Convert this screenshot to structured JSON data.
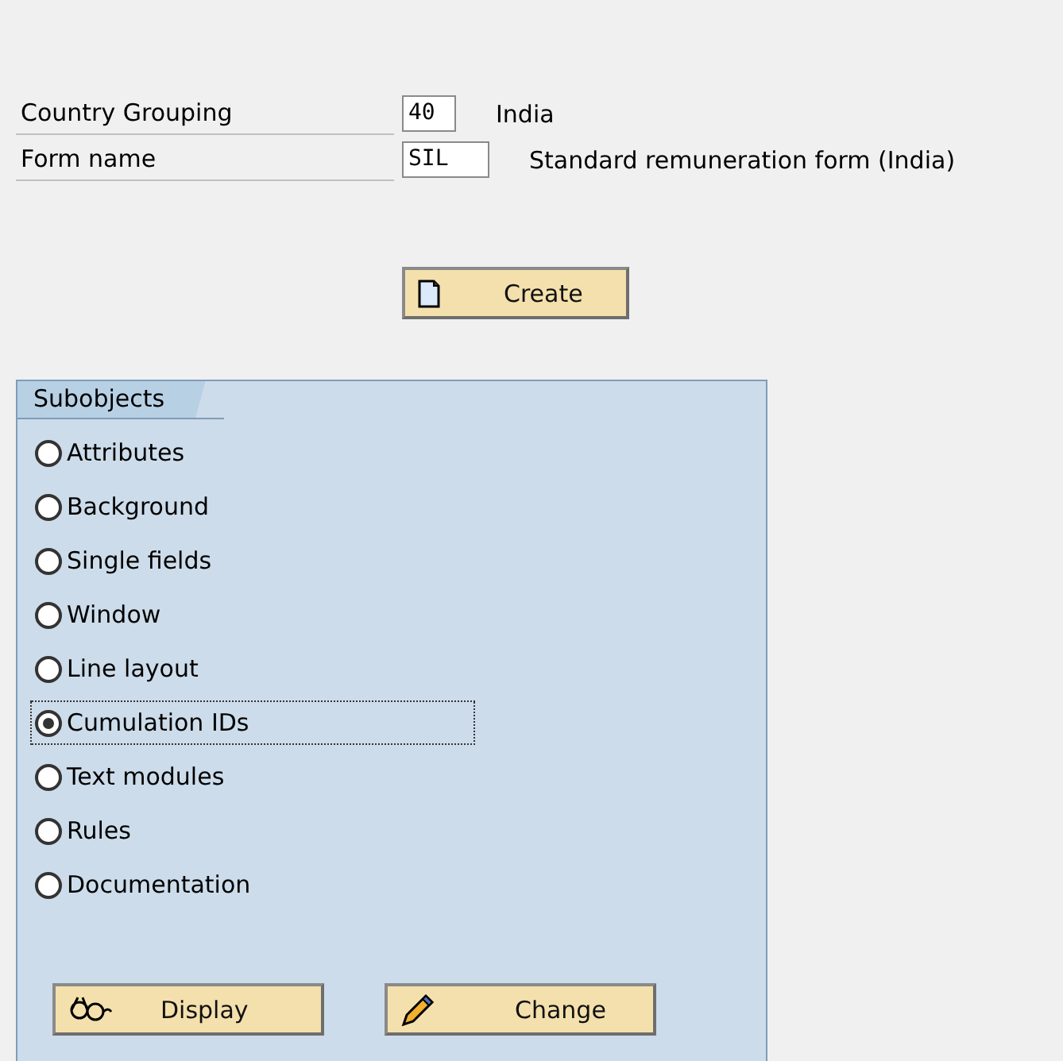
{
  "fields": [
    {
      "label": "Country Grouping",
      "value": "40",
      "description": "India"
    },
    {
      "label": "Form name",
      "value": "SIL",
      "description": "Standard remuneration form (India)"
    }
  ],
  "create_button": {
    "label": "Create"
  },
  "subobjects": {
    "title": "Subobjects",
    "options": [
      {
        "label": "Attributes",
        "selected": false
      },
      {
        "label": "Background",
        "selected": false
      },
      {
        "label": "Single fields",
        "selected": false
      },
      {
        "label": "Window",
        "selected": false
      },
      {
        "label": "Line layout",
        "selected": false
      },
      {
        "label": "Cumulation IDs",
        "selected": true
      },
      {
        "label": "Text modules",
        "selected": false
      },
      {
        "label": "Rules",
        "selected": false
      },
      {
        "label": "Documentation",
        "selected": false
      }
    ],
    "buttons": [
      {
        "kind": "display",
        "label": "Display"
      },
      {
        "kind": "change",
        "label": "Change"
      }
    ]
  }
}
